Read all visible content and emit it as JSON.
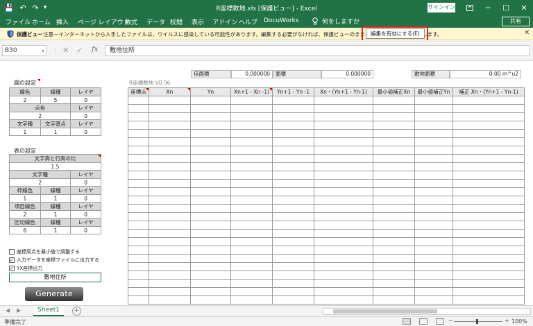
{
  "window": {
    "title": "R座標数地.xls [保護ビュー] - Excel",
    "signin": "サインイン",
    "minimize": "─",
    "maximize": "☐",
    "close": "✕"
  },
  "quick_access": {
    "save": "💾",
    "undo": "↶",
    "redo": "↷",
    "customize": "▾"
  },
  "ribbon": {
    "tabs": [
      "ファイル",
      "ホーム",
      "挿入",
      "ページ レイアウト",
      "数式",
      "データ",
      "校閲",
      "表示",
      "アドイン",
      "ヘルプ",
      "DocuWorks"
    ],
    "tell_me": "何をしますか",
    "share": "共有"
  },
  "protected_view": {
    "label": "保護ビュー",
    "message": "注意—インターネットから入手したファイルは、ウイルスに感染している可能性があります。編集する必要がなければ、保護ビューのままにしておくことをお勧めします。",
    "enable_button": "編集を有効にする(E)",
    "close": "✕"
  },
  "formula_bar": {
    "name_box": "B30",
    "fx": "fx",
    "cancel": "✕",
    "enter": "✓",
    "value": "敷地住所"
  },
  "figure_settings": {
    "title": "図の設定",
    "row1": {
      "headers": [
        "線色",
        "線種",
        "レイヤ"
      ],
      "values": [
        "2",
        "5",
        "0"
      ]
    },
    "row2": {
      "headers": [
        "点色",
        "レイヤ"
      ],
      "values": [
        "2",
        "0"
      ]
    },
    "row3": {
      "headers": [
        "文字種",
        "文字基点",
        "レイヤ"
      ],
      "values": [
        "1",
        "1",
        "0"
      ]
    }
  },
  "table_settings": {
    "title": "表の設定",
    "ratio": {
      "header": "文字高と行高の比",
      "value": "1.5"
    },
    "text_row": {
      "headers": [
        "文字種",
        "レイヤ"
      ],
      "values": [
        "2",
        "0"
      ]
    },
    "frame_row": {
      "headers": [
        "枠線色",
        "線種",
        "レイヤ"
      ],
      "values": [
        "1",
        "1",
        "0"
      ]
    },
    "item_row": {
      "headers": [
        "項目線色",
        "線種",
        "レイヤ"
      ],
      "values": [
        "2",
        "1",
        "0"
      ]
    },
    "divider_row": {
      "headers": [
        "区切線色",
        "線種",
        "レイヤ"
      ],
      "values": [
        "6",
        "1",
        "0"
      ]
    }
  },
  "options": [
    {
      "label": "座標原点を最小値で調整する",
      "checked": false
    },
    {
      "label": "入力データを座標ファイルに出力する",
      "checked": true
    },
    {
      "label": "YX座標出力",
      "checked": true
    }
  ],
  "address_cell": "敷地住所",
  "generate_button": "Generate",
  "version": "R座標数地 V0.96",
  "summary": {
    "double_area_label": "倍面積",
    "double_area_value": "0.000000",
    "area_label": "面積",
    "area_value": "0.000000",
    "site_area_label": "敷地面積",
    "site_area_value": "0.00 m^u2"
  },
  "grid": {
    "headers": [
      "座標点",
      "Xn",
      "Yn",
      "Xn+1 - Xn -1)",
      "Yn+1 - Yn -1",
      "Xn・(Yn+1 - Yn-1)",
      "最小値補正Xn",
      "最小値補正Yn",
      "補正 Xn・(Yn+1 - Yn-1)"
    ]
  },
  "sheet_tabs": {
    "active": "Sheet1",
    "add": "+",
    "prev": "◀",
    "next": "▶"
  },
  "status": {
    "ready": "準備完了",
    "zoom": "100%",
    "zoom_minus": "−",
    "zoom_plus": "+"
  },
  "colors": {
    "excel_green": "#217346",
    "protected_bar": "#fff7cf",
    "highlight_red": "#e02020"
  }
}
